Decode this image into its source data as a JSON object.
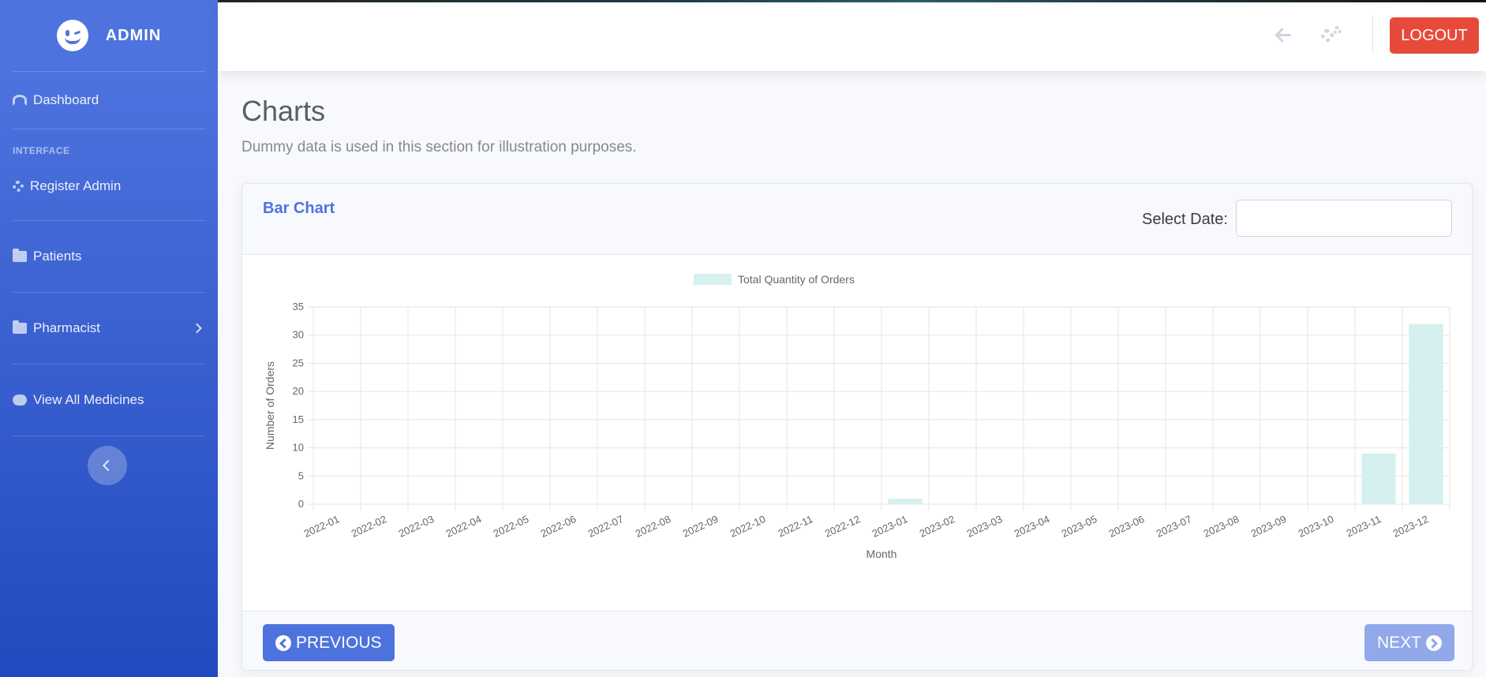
{
  "sidebar": {
    "brand": "ADMIN",
    "heading": "INTERFACE",
    "items": [
      {
        "label": "Dashboard",
        "icon": "dashboard-icon"
      },
      {
        "label": "Register Admin",
        "icon": "gear-icon"
      },
      {
        "label": "Patients",
        "icon": "folder-icon"
      },
      {
        "label": "Pharmacist",
        "icon": "folder-icon"
      },
      {
        "label": "View All Medicines",
        "icon": "pills-icon"
      }
    ]
  },
  "topbar": {
    "logout_label": "LOGOUT"
  },
  "page": {
    "title": "Charts",
    "subtitle": "Dummy data is used in this section for illustration purposes."
  },
  "card": {
    "title": "Bar Chart",
    "date_label": "Select Date:",
    "date_value": "",
    "prev_label": "PREVIOUS",
    "next_label": "NEXT"
  },
  "chart_data": {
    "type": "bar",
    "xlabel": "Month",
    "ylabel": "Number of Orders",
    "ylim": [
      0,
      35
    ],
    "yticks": [
      0,
      5,
      10,
      15,
      20,
      25,
      30,
      35
    ],
    "legend_position": "top-center",
    "grid": true,
    "bar_color": "#d6f0f0",
    "categories": [
      "2022-01",
      "2022-02",
      "2022-03",
      "2022-04",
      "2022-05",
      "2022-06",
      "2022-07",
      "2022-08",
      "2022-09",
      "2022-10",
      "2022-11",
      "2022-12",
      "2023-01",
      "2023-02",
      "2023-03",
      "2023-04",
      "2023-05",
      "2023-06",
      "2023-07",
      "2023-08",
      "2023-09",
      "2023-10",
      "2023-11",
      "2023-12"
    ],
    "series": [
      {
        "name": "Total Quantity of Orders",
        "values": [
          0,
          0,
          0,
          0,
          0,
          0,
          0,
          0,
          0,
          0,
          0,
          0,
          1,
          0,
          0,
          0,
          0,
          0,
          0,
          0,
          0,
          0,
          9,
          32
        ]
      }
    ]
  }
}
